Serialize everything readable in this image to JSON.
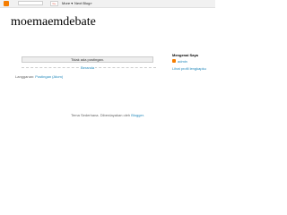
{
  "navbar": {
    "gplus_label": "G+",
    "more_label": "More ▾",
    "next_blog_label": "Next Blog»"
  },
  "blog": {
    "title": "moemaemdebate"
  },
  "main": {
    "no_posts_message": "Tidak ada postingan.",
    "home_link": "Beranda",
    "subscribe_prefix": "Langganan:",
    "subscribe_link": "Postingan (Atom)"
  },
  "sidebar": {
    "heading": "Mengenai Saya",
    "profile_name": "admin",
    "profile_link": "Lihat profil lengkapku"
  },
  "footer": {
    "prefix": "Tema Sederhana. Diberdayakan oleh",
    "link": "Blogger."
  },
  "colors": {
    "accent_link": "#2288bb",
    "blogger_orange": "#f57d00"
  }
}
